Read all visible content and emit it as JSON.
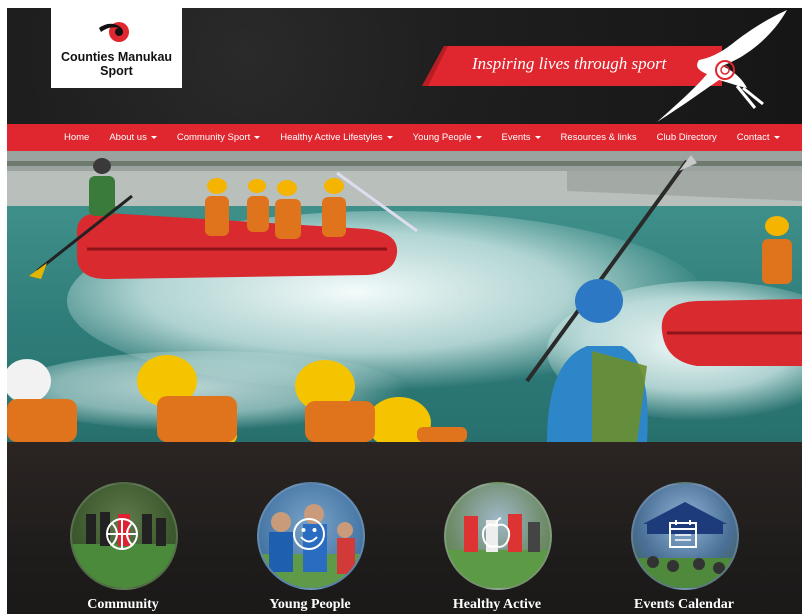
{
  "logo": {
    "line1": "Counties Manukau",
    "line2": "Sport"
  },
  "tagline": "Inspiring lives through sport",
  "nav": [
    {
      "label": "Home",
      "dropdown": false
    },
    {
      "label": "About us",
      "dropdown": true
    },
    {
      "label": "Community Sport",
      "dropdown": true
    },
    {
      "label": "Healthy Active Lifestyles",
      "dropdown": true
    },
    {
      "label": "Young People",
      "dropdown": true
    },
    {
      "label": "Events",
      "dropdown": true
    },
    {
      "label": "Resources & links",
      "dropdown": false
    },
    {
      "label": "Club Directory",
      "dropdown": false
    },
    {
      "label": "Contact",
      "dropdown": true
    }
  ],
  "features": [
    {
      "label": "Community",
      "icon": "basketball-icon"
    },
    {
      "label": "Young People",
      "icon": "smiley-icon"
    },
    {
      "label": "Healthy Active",
      "icon": "apple-icon"
    },
    {
      "label": "Events Calendar",
      "icon": "calendar-icon"
    }
  ],
  "colors": {
    "brand_red": "#e0262f",
    "header_dark": "#1e1e1e"
  }
}
